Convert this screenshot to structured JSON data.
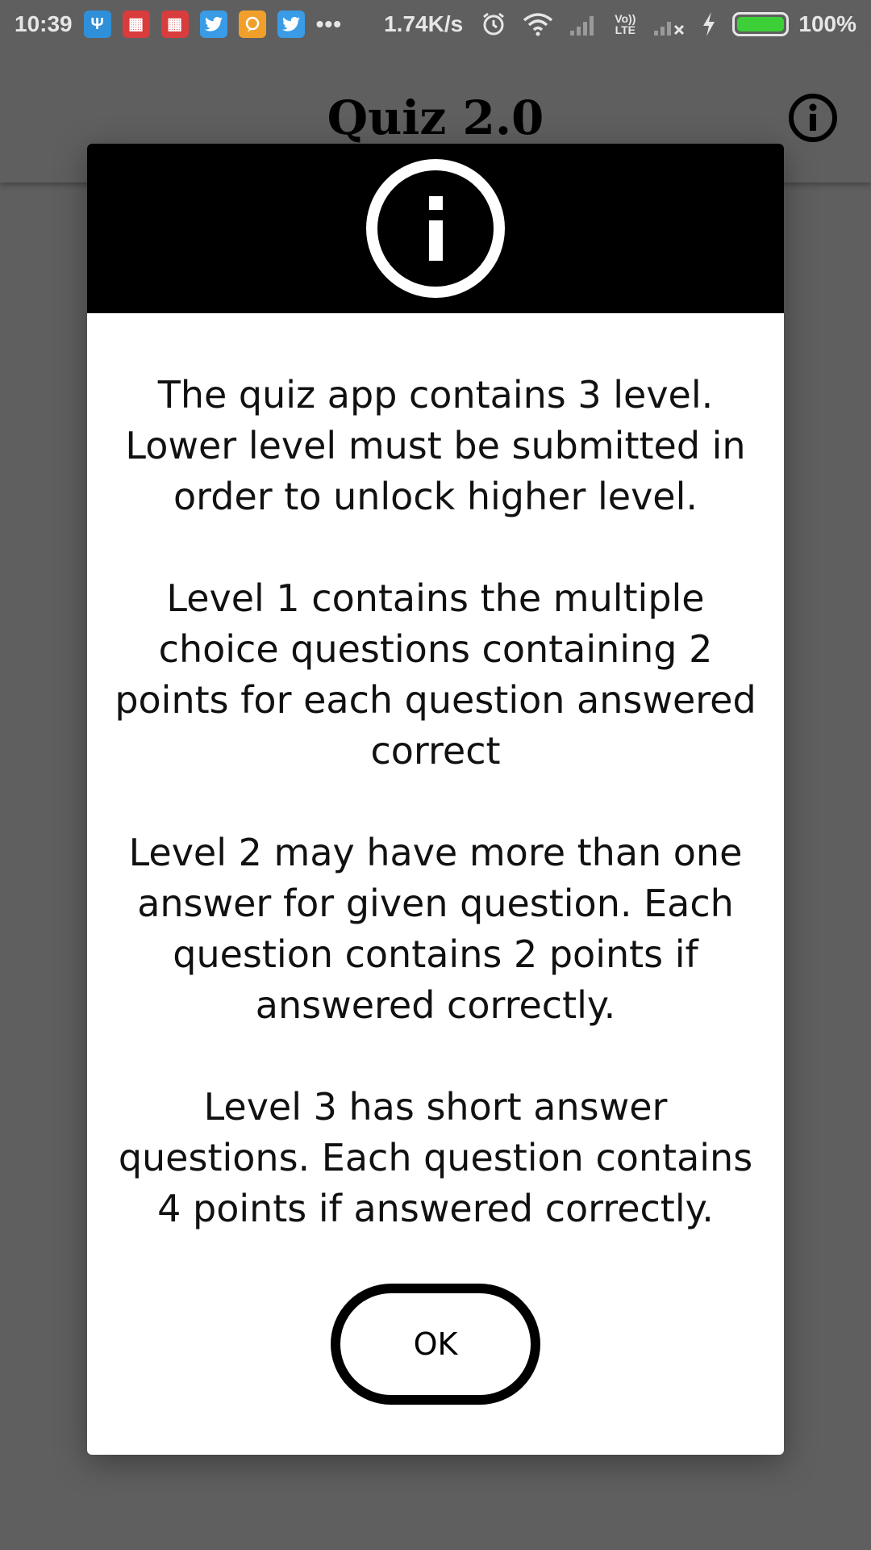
{
  "status_bar": {
    "time": "10:39",
    "more": "•••",
    "speed": "1.74K/s",
    "lte_top": "Vo))",
    "lte_bottom": "LTE",
    "battery_percent": "100%",
    "battery_level": 1.0,
    "battery_color": "#3ccf37",
    "notification_icons": [
      "usb-icon",
      "calendar-icon",
      "calendar-icon",
      "twitter-icon",
      "chat-icon",
      "twitter-icon"
    ]
  },
  "app_bar": {
    "title": "Quiz 2.0"
  },
  "dialog": {
    "header_icon": "info-icon",
    "paragraphs": [
      [
        "The quiz app contains 3 level.",
        "Lower level must be submitted in",
        "order to unlock higher level."
      ],
      [
        "Level 1 contains the multiple",
        "choice questions containing 2",
        "points for each question answered",
        "correct"
      ],
      [
        "Level 2 may have more than one",
        "answer for given question. Each",
        "question contains 2 points if",
        "answered correctly."
      ],
      [
        "Level 3 has short answer",
        "questions. Each question contains",
        "4 points if answered correctly."
      ]
    ],
    "ok_label": "OK"
  },
  "colors": {
    "scrim": "#5f5f5f",
    "dialog_header": "#000000",
    "dialog_body": "#ffffff"
  }
}
